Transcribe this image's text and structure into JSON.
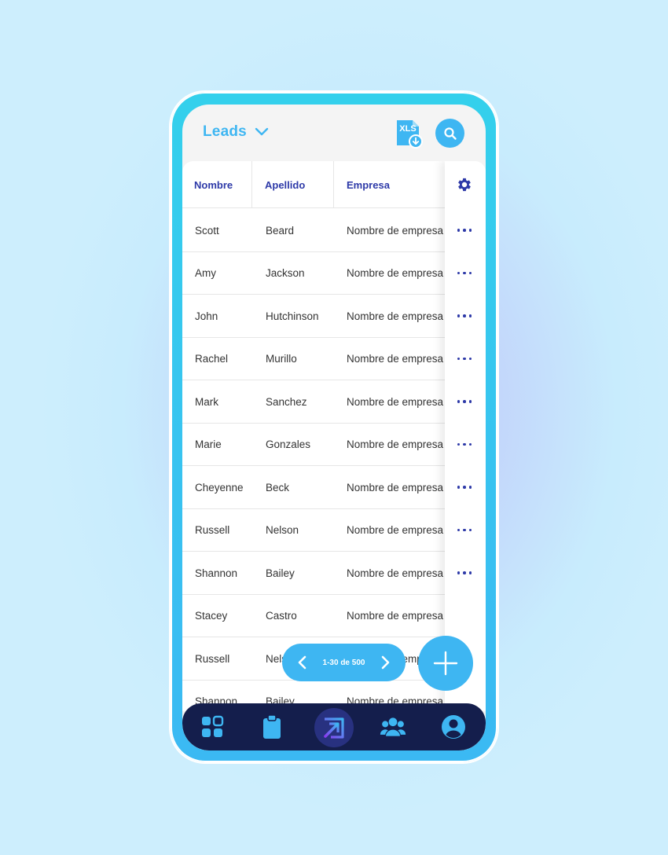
{
  "header": {
    "title": "Leads",
    "xls_label": "XLS"
  },
  "table": {
    "columns": [
      "Nombre",
      "Apellido",
      "Empresa"
    ],
    "rows": [
      {
        "first": "Scott",
        "last": "Beard",
        "company": "Nombre de empresa",
        "has_actions": true
      },
      {
        "first": "Amy",
        "last": "Jackson",
        "company": "Nombre de empresa",
        "has_actions": true
      },
      {
        "first": "John",
        "last": "Hutchinson",
        "company": "Nombre de empresa",
        "has_actions": true
      },
      {
        "first": "Rachel",
        "last": "Murillo",
        "company": "Nombre de empresa la",
        "has_actions": true
      },
      {
        "first": "Mark",
        "last": "Sanchez",
        "company": "Nombre de empresa",
        "has_actions": true
      },
      {
        "first": "Marie",
        "last": "Gonzales",
        "company": "Nombre de empresa",
        "has_actions": true
      },
      {
        "first": "Cheyenne",
        "last": "Beck",
        "company": "Nombre de empresa",
        "has_actions": true
      },
      {
        "first": "Russell",
        "last": "Nelson",
        "company": "Nombre de empresa",
        "has_actions": true
      },
      {
        "first": "Shannon",
        "last": "Bailey",
        "company": "Nombre de empresa",
        "has_actions": true
      },
      {
        "first": "Stacey",
        "last": "Castro",
        "company": "Nombre de empresa",
        "has_actions": false
      },
      {
        "first": "Russell",
        "last": "Nelson",
        "company": "Nombre de empresa",
        "has_actions": false
      },
      {
        "first": "Shannon",
        "last": "Bailey",
        "company": "Nombre de empresa",
        "has_actions": false
      }
    ]
  },
  "pager": {
    "label": "1-30 de 500"
  },
  "bottom_nav": {
    "items": [
      "dashboard-icon",
      "clipboard-icon",
      "leads-icon",
      "team-icon",
      "profile-icon"
    ]
  },
  "colors": {
    "accent": "#3eb6f2",
    "header_text": "#2e3aa8",
    "nav_bg": "#141e4c"
  }
}
